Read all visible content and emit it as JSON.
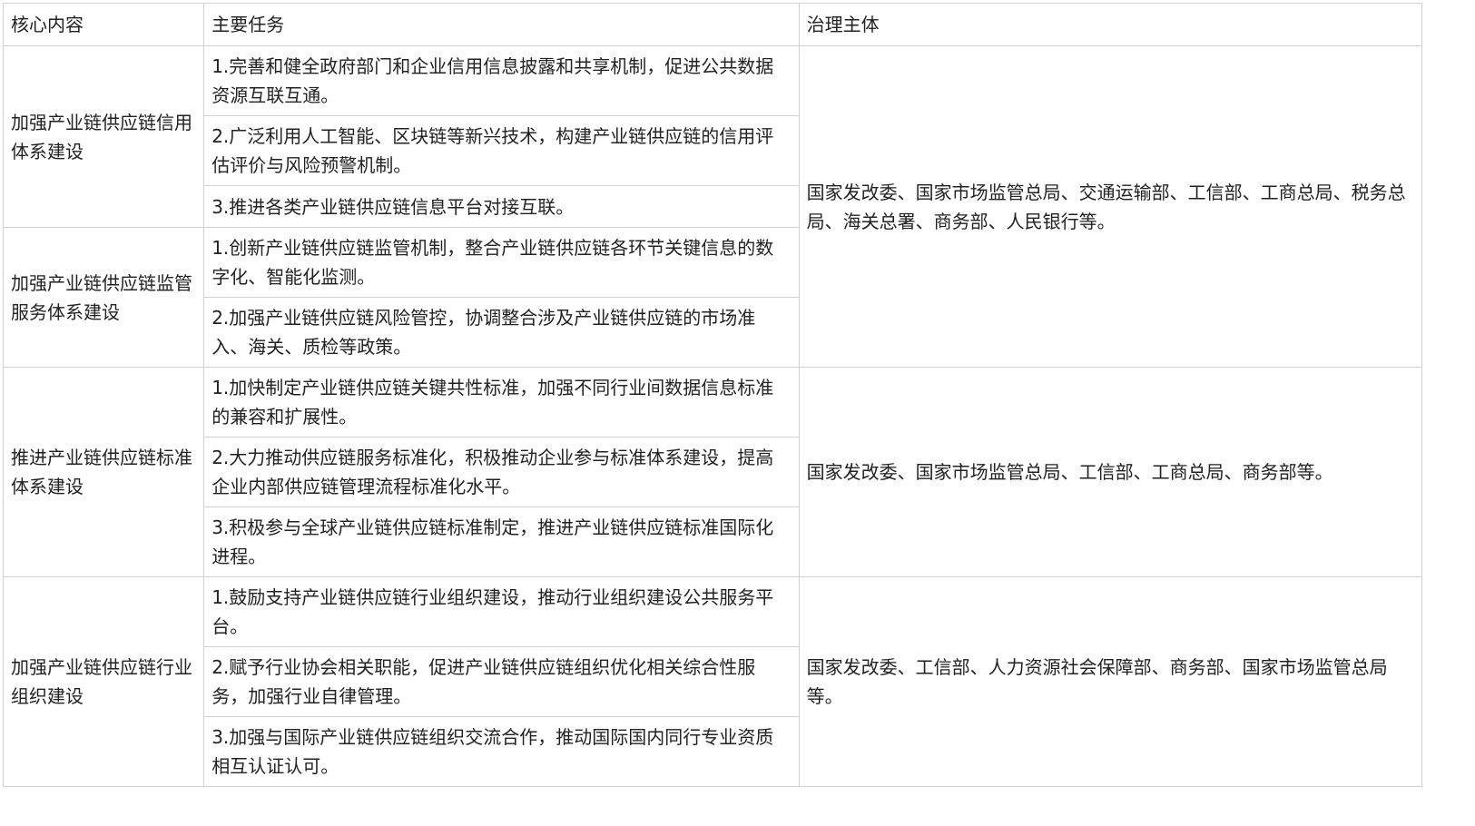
{
  "table": {
    "headers": {
      "core": "核心内容",
      "task": "主要任务",
      "body": "治理主体"
    },
    "groups": [
      {
        "core": "加强产业链供应链信用体系建设",
        "tasks": [
          "1.完善和健全政府部门和企业信用信息披露和共享机制，促进公共数据资源互联互通。",
          "2.广泛利用人工智能、区块链等新兴技术，构建产业链供应链的信用评估评价与风险预警机制。",
          "3.推进各类产业链供应链信息平台对接互联。"
        ],
        "body": "国家发改委、国家市场监管总局、交通运输部、工信部、工商总局、税务总局、海关总署、商务部、人民银行等。"
      },
      {
        "core": "加强产业链供应链监管服务体系建设",
        "tasks": [
          "1.创新产业链供应链监管机制，整合产业链供应链各环节关键信息的数字化、智能化监测。",
          "2.加强产业链供应链风险管控，协调整合涉及产业链供应链的市场准入、海关、质检等政策。"
        ],
        "body": ""
      },
      {
        "core": "推进产业链供应链标准体系建设",
        "tasks": [
          "1.加快制定产业链供应链关键共性标准，加强不同行业间数据信息标准的兼容和扩展性。",
          "2.大力推动供应链服务标准化，积极推动企业参与标准体系建设，提高企业内部供应链管理流程标准化水平。",
          "3.积极参与全球产业链供应链标准制定，推进产业链供应链标准国际化进程。"
        ],
        "body": "国家发改委、国家市场监管总局、工信部、工商总局、商务部等。"
      },
      {
        "core": "加强产业链供应链行业组织建设",
        "tasks": [
          "1.鼓励支持产业链供应链行业组织建设，推动行业组织建设公共服务平台。",
          "2.赋予行业协会相关职能，促进产业链供应链组织优化相关综合性服务，加强行业自律管理。",
          "3.加强与国际产业链供应链组织交流合作，推动国际国内同行专业资质相互认证认可。"
        ],
        "body": "国家发改委、工信部、人力资源社会保障部、商务部、国家市场监管总局等。"
      }
    ]
  }
}
